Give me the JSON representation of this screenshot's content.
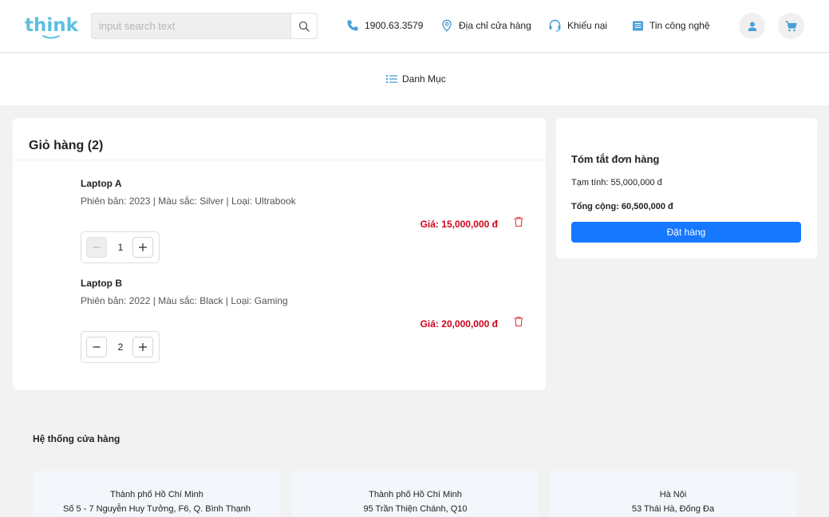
{
  "header": {
    "logo_text": "think",
    "search": {
      "placeholder": "input search text",
      "value": ""
    },
    "links": [
      {
        "label": "1900.63.3579",
        "icon": "phone-icon"
      },
      {
        "label": "Địa chỉ cửa hàng",
        "icon": "location-pin-icon"
      },
      {
        "label": "Khiếu nại",
        "icon": "headset-icon"
      },
      {
        "label": "Tin công nghệ",
        "icon": "news-icon"
      }
    ],
    "account_icon": "user-icon",
    "cart_icon": "cart-icon"
  },
  "menu": {
    "label": "Danh Mục",
    "icon": "list-icon"
  },
  "cart": {
    "title": "Giỏ hàng (2)",
    "items": [
      {
        "name": "Laptop A",
        "spec": "Phiên bản: 2023 | Màu sắc: Silver | Loại: Ultrabook",
        "price": "Giá: 15,000,000 đ",
        "quantity": "1",
        "minus_disabled": true
      },
      {
        "name": "Laptop B",
        "spec": "Phiên bản: 2022 | Màu sắc: Black | Loại: Gaming",
        "price": "Giá: 20,000,000 đ",
        "quantity": "2",
        "minus_disabled": false
      }
    ]
  },
  "summary": {
    "title": "Tóm tắt đơn hàng",
    "subtotal": "Tạm tính: 55,000,000 đ",
    "total": "Tổng cộng: 60,500,000 đ",
    "order_button": "Đặt hàng"
  },
  "stores": {
    "title": "Hệ thống cửa hàng",
    "items": [
      {
        "city": "Thành phố Hồ Chí Minh",
        "address": "Số 5 - 7 Nguyễn Huy Tưởng, F6, Q. Bình Thạnh"
      },
      {
        "city": "Thành phố Hồ Chí Minh",
        "address": "95 Trần Thiện Chánh, Q10"
      },
      {
        "city": "Hà Nội",
        "address": "53 Thái Hà, Đống Đa"
      }
    ]
  },
  "colors": {
    "brand": "#5bbfe0",
    "primary_button": "#1677ff",
    "price": "#d0021b",
    "delete_icon": "#e5484d",
    "header_icon": "#4a9fd8"
  }
}
